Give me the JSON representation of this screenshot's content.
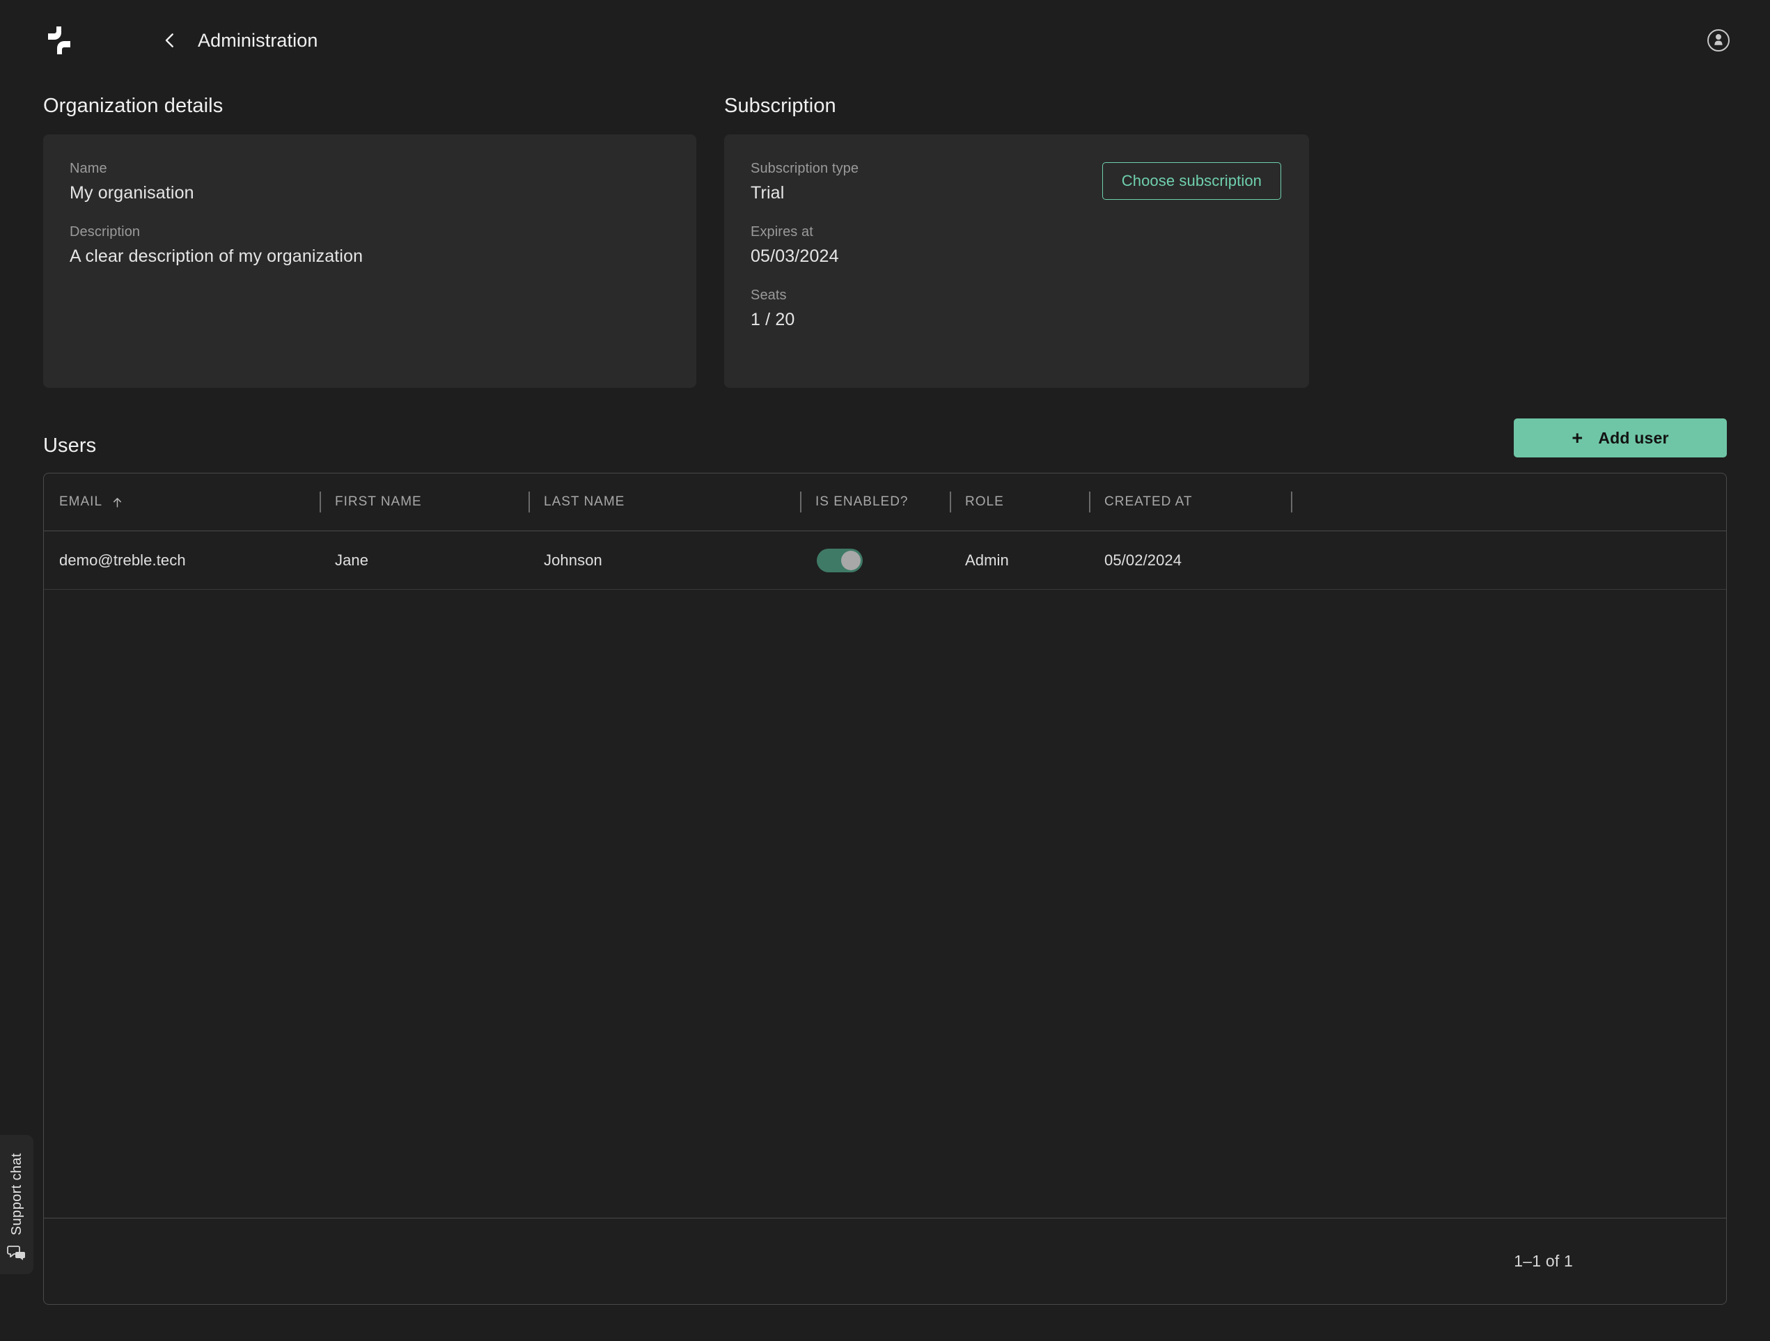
{
  "header": {
    "title": "Administration",
    "logo_icon": "treble-logo-icon",
    "back_icon": "chevron-left-icon",
    "account_icon": "account-circle-icon"
  },
  "organization": {
    "heading": "Organization details",
    "fields": [
      {
        "label": "Name",
        "value": "My organisation"
      },
      {
        "label": "Description",
        "value": "A clear description of my organization"
      }
    ]
  },
  "subscription": {
    "heading": "Subscription",
    "choose_label": "Choose subscription",
    "fields": [
      {
        "label": "Subscription type",
        "value": "Trial"
      },
      {
        "label": "Expires at",
        "value": "05/03/2024"
      },
      {
        "label": "Seats",
        "value": "1 / 20"
      }
    ]
  },
  "users": {
    "heading": "Users",
    "add_user_label": "Add user",
    "add_user_plus": "+",
    "columns": [
      {
        "key": "email",
        "label": "EMAIL",
        "sorted": "asc",
        "sort_icon": "arrow-up-icon"
      },
      {
        "key": "first",
        "label": "FIRST NAME"
      },
      {
        "key": "last",
        "label": "LAST NAME"
      },
      {
        "key": "enabled",
        "label": "IS ENABLED?"
      },
      {
        "key": "role",
        "label": "ROLE"
      },
      {
        "key": "created",
        "label": "CREATED AT"
      }
    ],
    "rows": [
      {
        "email": "demo@treble.tech",
        "first": "Jane",
        "last": "Johnson",
        "enabled": true,
        "role": "Admin",
        "created": "05/02/2024"
      }
    ],
    "pagination": "1–1 of 1"
  },
  "support_chat": {
    "label": "Support chat",
    "icon": "chat-bubbles-icon"
  },
  "colors": {
    "page_background": "#1e1e1e",
    "card_background": "#2a2a2a",
    "accent_green": "#6fc6a6",
    "accent_green_outline": "#6fd0ad",
    "toggle_on_track": "#3f7a67",
    "border": "#4a4a4a",
    "text_primary": "#e6e6e6",
    "text_muted": "#9a9a9a"
  }
}
